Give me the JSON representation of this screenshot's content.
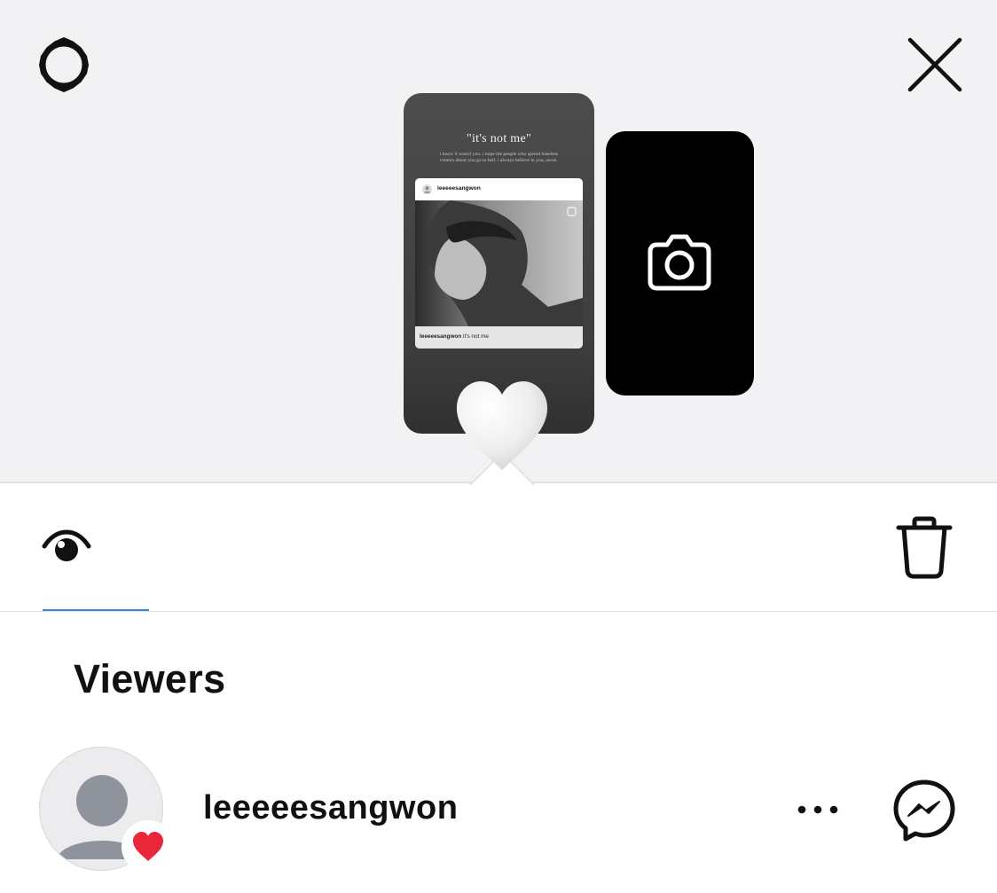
{
  "header": {
    "settings_icon": "gear-icon",
    "close_icon": "close-icon"
  },
  "story": {
    "quote_title": "\"it's not me\"",
    "quote_subtitle": "i know it wasn't you. i hope the people who spread baseless rumors about you go to hell. i always believe in you, awon.",
    "post_username": "leeeeesangwon",
    "post_caption_user": "leeeeesangwon",
    "post_caption_text": " it's not me",
    "reaction_icon": "heart-icon"
  },
  "camera_card": {
    "icon": "camera-icon"
  },
  "tabs": {
    "views_icon": "eye-icon",
    "delete_icon": "trash-icon",
    "active_color": "#3a8ad8"
  },
  "viewers": {
    "title": "Viewers",
    "items": [
      {
        "username": "leeeeesangwon",
        "reaction": "heart",
        "reaction_color": "#e8283a",
        "more_icon": "more-icon",
        "message_icon": "messenger-icon"
      }
    ]
  }
}
